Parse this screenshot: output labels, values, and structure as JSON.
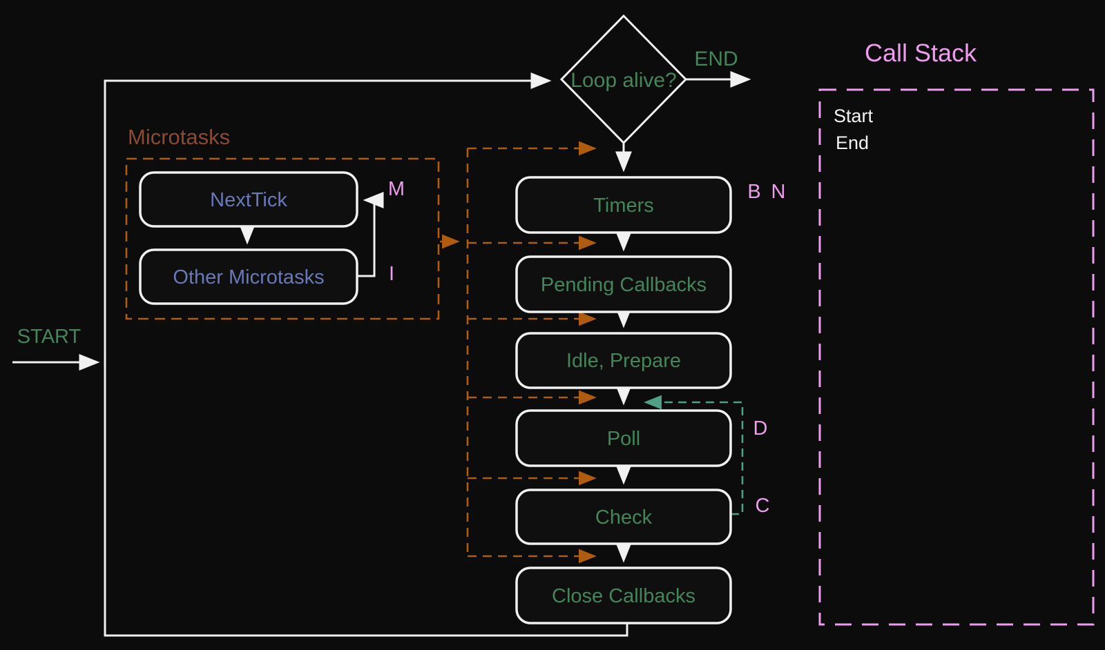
{
  "colors": {
    "background": "#0c0c0c",
    "white": "#f1f1f1",
    "green": "#45855a",
    "pink": "#ee9dee",
    "blue": "#6a79b5",
    "brown": "#8c4a35",
    "orange": "#b05c10",
    "teal": "#4fa086"
  },
  "diagram": {
    "start_label": "START",
    "end_label": "END",
    "decision_label": "Loop alive?",
    "microtasks": {
      "title": "Microtasks",
      "nodes": [
        "NextTick",
        "Other Microtasks"
      ],
      "loop_labels": {
        "m": "M",
        "i": "I"
      }
    },
    "phases": [
      "Timers",
      "Pending Callbacks",
      "Idle, Prepare",
      "Poll",
      "Check",
      "Close Callbacks"
    ],
    "phase_markers": {
      "b": "B",
      "n": "N",
      "d": "D",
      "c": "C"
    },
    "call_stack": {
      "title": "Call Stack",
      "entries": [
        "Start",
        "End"
      ]
    }
  }
}
